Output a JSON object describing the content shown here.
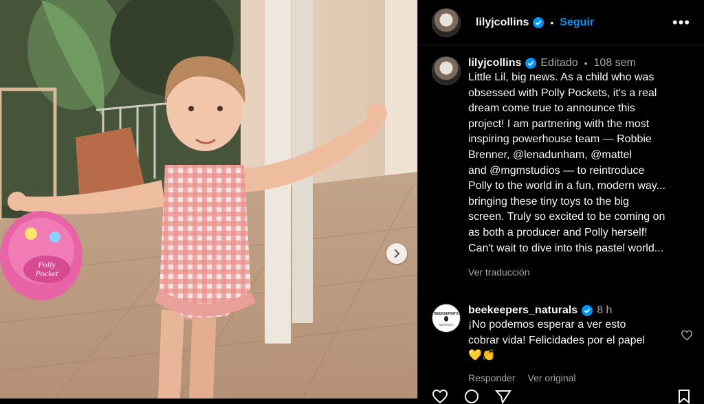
{
  "post": {
    "username": "lilyjcollins",
    "follow_label": "Seguir",
    "more_label": "•••"
  },
  "caption": {
    "username": "lilyjcollins",
    "edited_label": "Editado",
    "time": "108 sem",
    "text_lines": [
      "Little Lil, big news. As a child who was",
      "obsessed with Polly Pockets, it's a real",
      "dream come true to announce this",
      "project! I am partnering with the most",
      "inspiring powerhouse team — Robbie",
      "Brenner, @lenadunham, @mattel",
      "and @mgmstudios — to reintroduce",
      "Polly to the world in a fun, modern way...",
      "bringing these tiny toys to the big",
      "screen. Truly so excited to be coming on",
      "as both a producer and Polly herself!",
      "Can't wait to dive into this pastel world..."
    ],
    "translate_label": "Ver traducción"
  },
  "comment": {
    "username": "beekeepers_naturals",
    "time": "8 h",
    "text_line1": "¡No podemos esperar a ver esto",
    "text_line2": "cobrar vida! Felicidades por el papel",
    "emoji": "💛👏",
    "avatar_text_top": "BEEKEEPER'S",
    "avatar_text_bottom": "NATURALS",
    "reply_label": "Responder",
    "original_label": "Ver original"
  },
  "photo": {
    "toy_label_1": "Polly",
    "toy_label_2": "Pocket"
  },
  "colors": {
    "accent": "#0095f6",
    "verified": "#0095f6",
    "muted": "#a8a8a8"
  }
}
